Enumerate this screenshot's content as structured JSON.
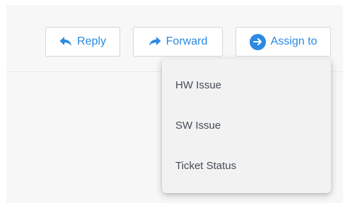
{
  "toolbar": {
    "reply_label": "Reply",
    "forward_label": "Forward",
    "assign_label": "Assign to"
  },
  "icons": {
    "reply": "reply-arrow-icon",
    "forward": "forward-arrow-icon",
    "assign": "arrow-right-circle-icon"
  },
  "dropdown": {
    "items": [
      {
        "label": "HW Issue"
      },
      {
        "label": "SW Issue"
      },
      {
        "label": "Ticket Status"
      }
    ]
  },
  "colors": {
    "accent": "#2b8ae2",
    "menu_text": "#444c56",
    "menu_bg": "#f2f2f2",
    "canvas_bg": "#f7f7f7"
  }
}
